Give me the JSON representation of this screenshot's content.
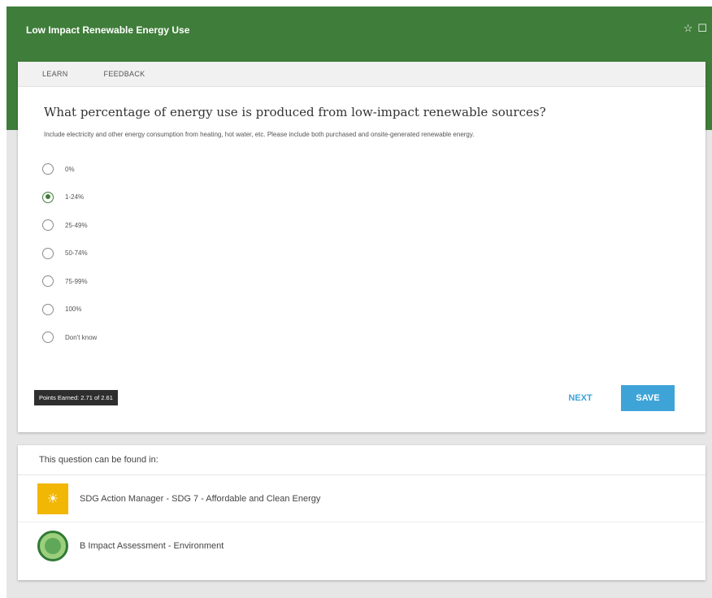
{
  "header": {
    "title": "Low Impact Renewable Energy Use",
    "star_icon": "☆",
    "bookmark_icon": "☐"
  },
  "tabs": [
    "LEARN",
    "FEEDBACK"
  ],
  "question": {
    "text": "What percentage of energy use is produced from low-impact renewable sources?",
    "help": "Include electricity and other energy consumption from heating, hot water, etc. Please include both purchased and onsite-generated renewable energy.",
    "options": [
      "0%",
      "1-24%",
      "25-49%",
      "50-74%",
      "75-99%",
      "100%",
      "Don't know"
    ],
    "selected": 1
  },
  "points_badge": "Points Earned: 2.71 of 2.61",
  "buttons": {
    "next": "NEXT",
    "save": "SAVE"
  },
  "found_in": {
    "title": "This question can be found in:",
    "items": [
      {
        "label": "SDG Action Manager - SDG 7 - Affordable and Clean Energy",
        "icon": "sdg-7-icon"
      },
      {
        "label": "B Impact Assessment - Environment",
        "icon": "environment-icon"
      }
    ]
  },
  "colors": {
    "header": "#3f7d3a",
    "accent": "#3ea4d8",
    "sdg": "#f2b705"
  }
}
